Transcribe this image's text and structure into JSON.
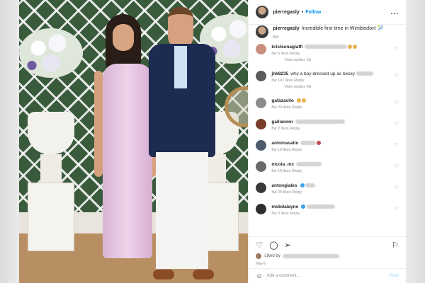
{
  "post": {
    "username": "pierregasly",
    "follow_label": "Follow",
    "more_label": "...",
    "caption_username": "pierregasly",
    "caption_text": "Incredible first time in Wimbledon! 🎾",
    "caption_time": "8w"
  },
  "comments": [
    {
      "username": "kristeenaglaffi",
      "text": "is there ANYTHING you two don't do in STYLE?",
      "meta": "8w  6 likes  Reply",
      "replies": "View replies (3)",
      "avatar": "#c78f7c"
    },
    {
      "username": "jhk8235",
      "text": "why a boy dressed up as becky",
      "meta": "8w  102 likes  Reply",
      "replies": "View replies (6)",
      "avatar": "#5a5a5a"
    },
    {
      "username": "gafazavilo",
      "text": "",
      "meta": "8w  24 likes  Reply",
      "replies": "",
      "avatar": "#8c8c8c"
    },
    {
      "username": "gallianmn",
      "text": "",
      "meta": "8w  2 likes  Reply",
      "replies": "",
      "avatar": "#7a3d2c"
    },
    {
      "username": "antoinasalin",
      "text": "",
      "meta": "8w  10 likes  Reply",
      "replies": "",
      "avatar": "#4d5b6a"
    },
    {
      "username": "nicola_mc",
      "text": "",
      "meta": "8w  10 likes  Reply",
      "replies": "",
      "avatar": "#6a6a6a"
    },
    {
      "username": "antongiales",
      "text": "",
      "meta": "8w  20 likes  Reply",
      "replies": "",
      "avatar": "#3a3a3a"
    },
    {
      "username": "mobdalayne",
      "text": "",
      "meta": "8w  3 likes  Reply",
      "replies": "",
      "avatar": "#2f2f2f"
    }
  ],
  "actions": {
    "like_icon": "heart-icon",
    "comment_icon": "comment-icon",
    "share_icon": "paper-plane-icon",
    "save_icon": "bookmark-icon"
  },
  "likes_text": "Liked by",
  "date_text": "May 6",
  "add_comment": {
    "placeholder": "Add a comment...",
    "post_label": "Post"
  }
}
